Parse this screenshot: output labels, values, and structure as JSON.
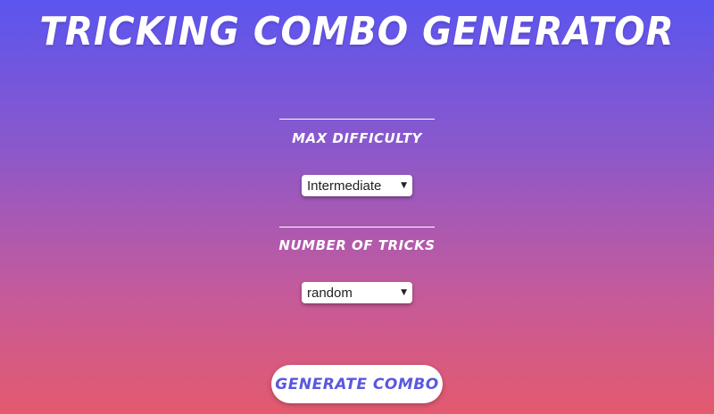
{
  "header": {
    "title": "TRICKING COMBO GENERATOR"
  },
  "difficulty": {
    "label": "MAX DIFFICULTY",
    "selected": "Intermediate"
  },
  "tricks": {
    "label": "NUMBER OF TRICKS",
    "selected": "random"
  },
  "actions": {
    "generate_label": "GENERATE COMBO"
  },
  "colors": {
    "gradient_top": "#5b55ef",
    "gradient_bottom": "#e45a6e",
    "button_text": "#5b57e0"
  }
}
